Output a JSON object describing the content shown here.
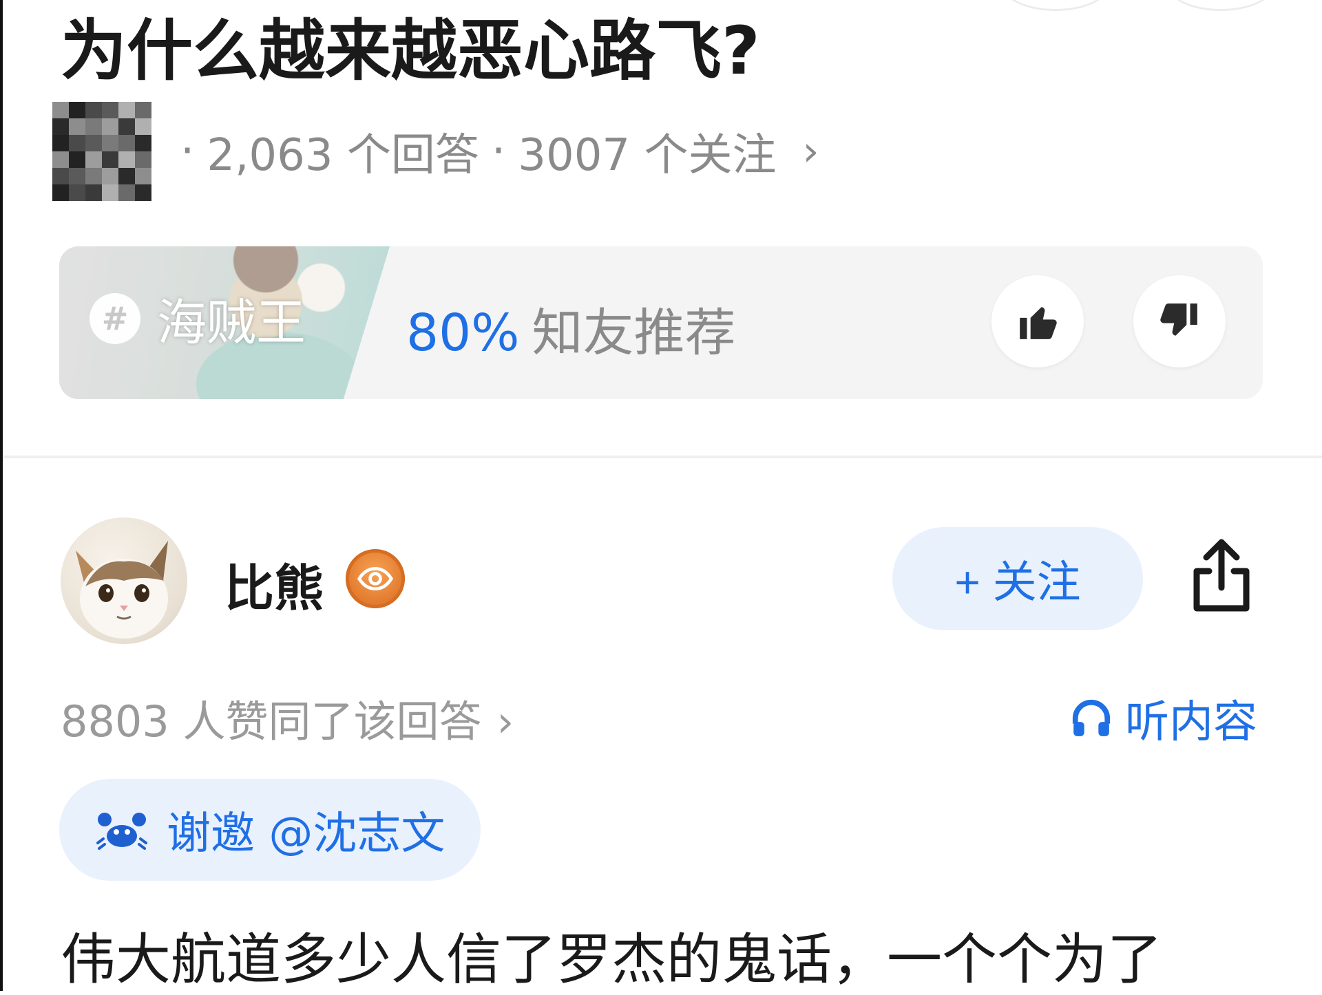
{
  "question": {
    "title": "为什么越来越恶心路飞?",
    "answers": "2,063 个回答",
    "followers": "3007 个关注",
    "separator": "·",
    "chevron": "›"
  },
  "topic": {
    "hash_symbol": "#",
    "name": "海贼王",
    "recommend_percent": "80%",
    "recommend_label": "知友推荐",
    "upvote_icon": "thumbs-up-icon",
    "downvote_icon": "thumbs-down-icon"
  },
  "answer": {
    "author_name": "比熊",
    "badge_icon": "eye-badge-icon",
    "follow_label": "+ 关注",
    "share_icon": "share-icon",
    "agree_text": "8803 人赞同了该回答",
    "agree_chevron": "›",
    "listen_label": "听内容",
    "invite_label": "谢邀 @沈志文",
    "content_first_line": "伟大航道多少人信了罗杰的鬼话，一个个为了"
  },
  "colors": {
    "accent_blue": "#1f6fe5",
    "pill_bg": "#e9f1fd",
    "muted_text": "#8a8a8a",
    "badge_orange": "#e2782a"
  }
}
